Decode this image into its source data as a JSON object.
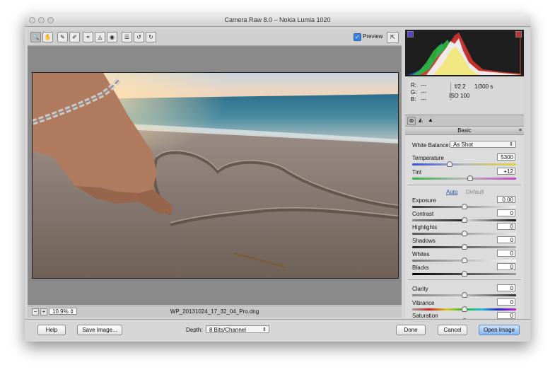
{
  "window": {
    "title": "Camera Raw 8.0  –  Nokia Lumia 1020"
  },
  "toolbar": {
    "tools": [
      {
        "icon": "zoom-icon",
        "glyph": "🔍"
      },
      {
        "icon": "hand-icon",
        "glyph": "✋"
      },
      {
        "icon": "white-balance-icon",
        "glyph": "✎"
      },
      {
        "icon": "color-sampler-icon",
        "glyph": "✐"
      },
      {
        "icon": "crop-icon",
        "glyph": "⌗"
      },
      {
        "icon": "straighten-icon",
        "glyph": "◬"
      },
      {
        "icon": "red-eye-icon",
        "glyph": "◉"
      },
      {
        "icon": "preferences-icon",
        "glyph": "☰"
      },
      {
        "icon": "rotate-left-icon",
        "glyph": "↺"
      },
      {
        "icon": "rotate-right-icon",
        "glyph": "↻"
      }
    ],
    "preview_label": "Preview",
    "preview_checked": "✓",
    "fullscreen_glyph": "⇱"
  },
  "status": {
    "zoom_out": "−",
    "zoom_in": "+",
    "zoom": "10.9%",
    "zoom_arrow": "⇕",
    "filename": "WP_20131024_17_32_04_Pro.dng"
  },
  "readout": {
    "r_label": "R:",
    "g_label": "G:",
    "b_label": "B:",
    "r_val": "---",
    "g_val": "---",
    "b_val": "---",
    "aperture": "f/2.2",
    "shutter": "1/300 s",
    "iso": "ISO 100"
  },
  "panel": {
    "section_title": "Basic",
    "menu_glyph": "≡",
    "white_balance_label": "White Balance:",
    "white_balance_value": "As Shot",
    "auto_label": "Auto",
    "default_label": "Default",
    "sliders": [
      {
        "label": "Temperature",
        "value": "5300",
        "level": 0.36
      },
      {
        "label": "Tint",
        "value": "+12",
        "level": 0.56
      },
      {
        "label": "Exposure",
        "value": "0.00",
        "level": 0.5
      },
      {
        "label": "Contrast",
        "value": "0",
        "level": 0.5
      },
      {
        "label": "Highlights",
        "value": "0",
        "level": 0.5
      },
      {
        "label": "Shadows",
        "value": "0",
        "level": 0.5
      },
      {
        "label": "Whites",
        "value": "0",
        "level": 0.5
      },
      {
        "label": "Blacks",
        "value": "0",
        "level": 0.5
      },
      {
        "label": "Clarity",
        "value": "0",
        "level": 0.5
      },
      {
        "label": "Vibrance",
        "value": "0",
        "level": 0.5
      },
      {
        "label": "Saturation",
        "value": "0",
        "level": 0.5
      }
    ]
  },
  "bottom": {
    "help": "Help",
    "save_image": "Save Image...",
    "depth_label": "Depth:",
    "depth_value": "8 Bits/Channel",
    "done": "Done",
    "cancel": "Cancel",
    "open_image": "Open Image"
  },
  "colors": {
    "accent": "#3a7de0",
    "link": "#2b4fa8",
    "primary_button": "#86b6ee"
  }
}
